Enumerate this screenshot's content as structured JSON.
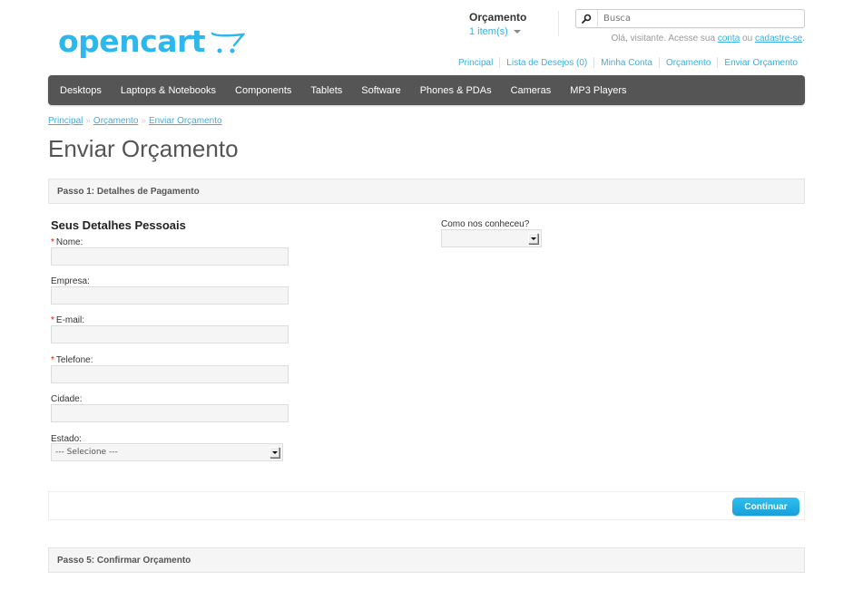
{
  "header": {
    "logo_text": "opencart",
    "cart": {
      "title": "Orçamento",
      "items": "1 item(s)"
    },
    "search": {
      "placeholder": "Busca"
    },
    "welcome": {
      "prefix": "Olá, visitante. Acesse sua ",
      "login_link": "conta",
      "middle": " ou ",
      "register_link": "cadastre-se",
      "suffix": "."
    },
    "links": [
      "Principal",
      "Lista de Desejos (0)",
      "Minha Conta",
      "Orçamento",
      "Enviar Orçamento"
    ]
  },
  "menu": [
    "Desktops",
    "Laptops & Notebooks",
    "Components",
    "Tablets",
    "Software",
    "Phones & PDAs",
    "Cameras",
    "MP3 Players"
  ],
  "breadcrumb": [
    "Principal",
    "Orçamento",
    "Enviar Orçamento"
  ],
  "breadcrumb_sep": "»",
  "page_title": "Enviar Orçamento",
  "step1": {
    "header": "Passo 1: Detalhes de Pagamento",
    "section_title": "Seus Detalhes Pessoais",
    "required_mark": "*",
    "fields": {
      "nome": {
        "label": "Nome:",
        "value": ""
      },
      "empresa": {
        "label": "Empresa:",
        "value": ""
      },
      "email": {
        "label": "E-mail:",
        "value": ""
      },
      "telefone": {
        "label": "Telefone:",
        "value": ""
      },
      "cidade": {
        "label": "Cidade:",
        "value": ""
      },
      "estado": {
        "label": "Estado:",
        "selected": "--- Selecione ---"
      }
    },
    "como_conheceu": {
      "label": "Como nos conheceu?",
      "selected": ""
    },
    "continue_button": "Continuar"
  },
  "step5": {
    "header": "Passo 5: Confirmar Orçamento"
  }
}
